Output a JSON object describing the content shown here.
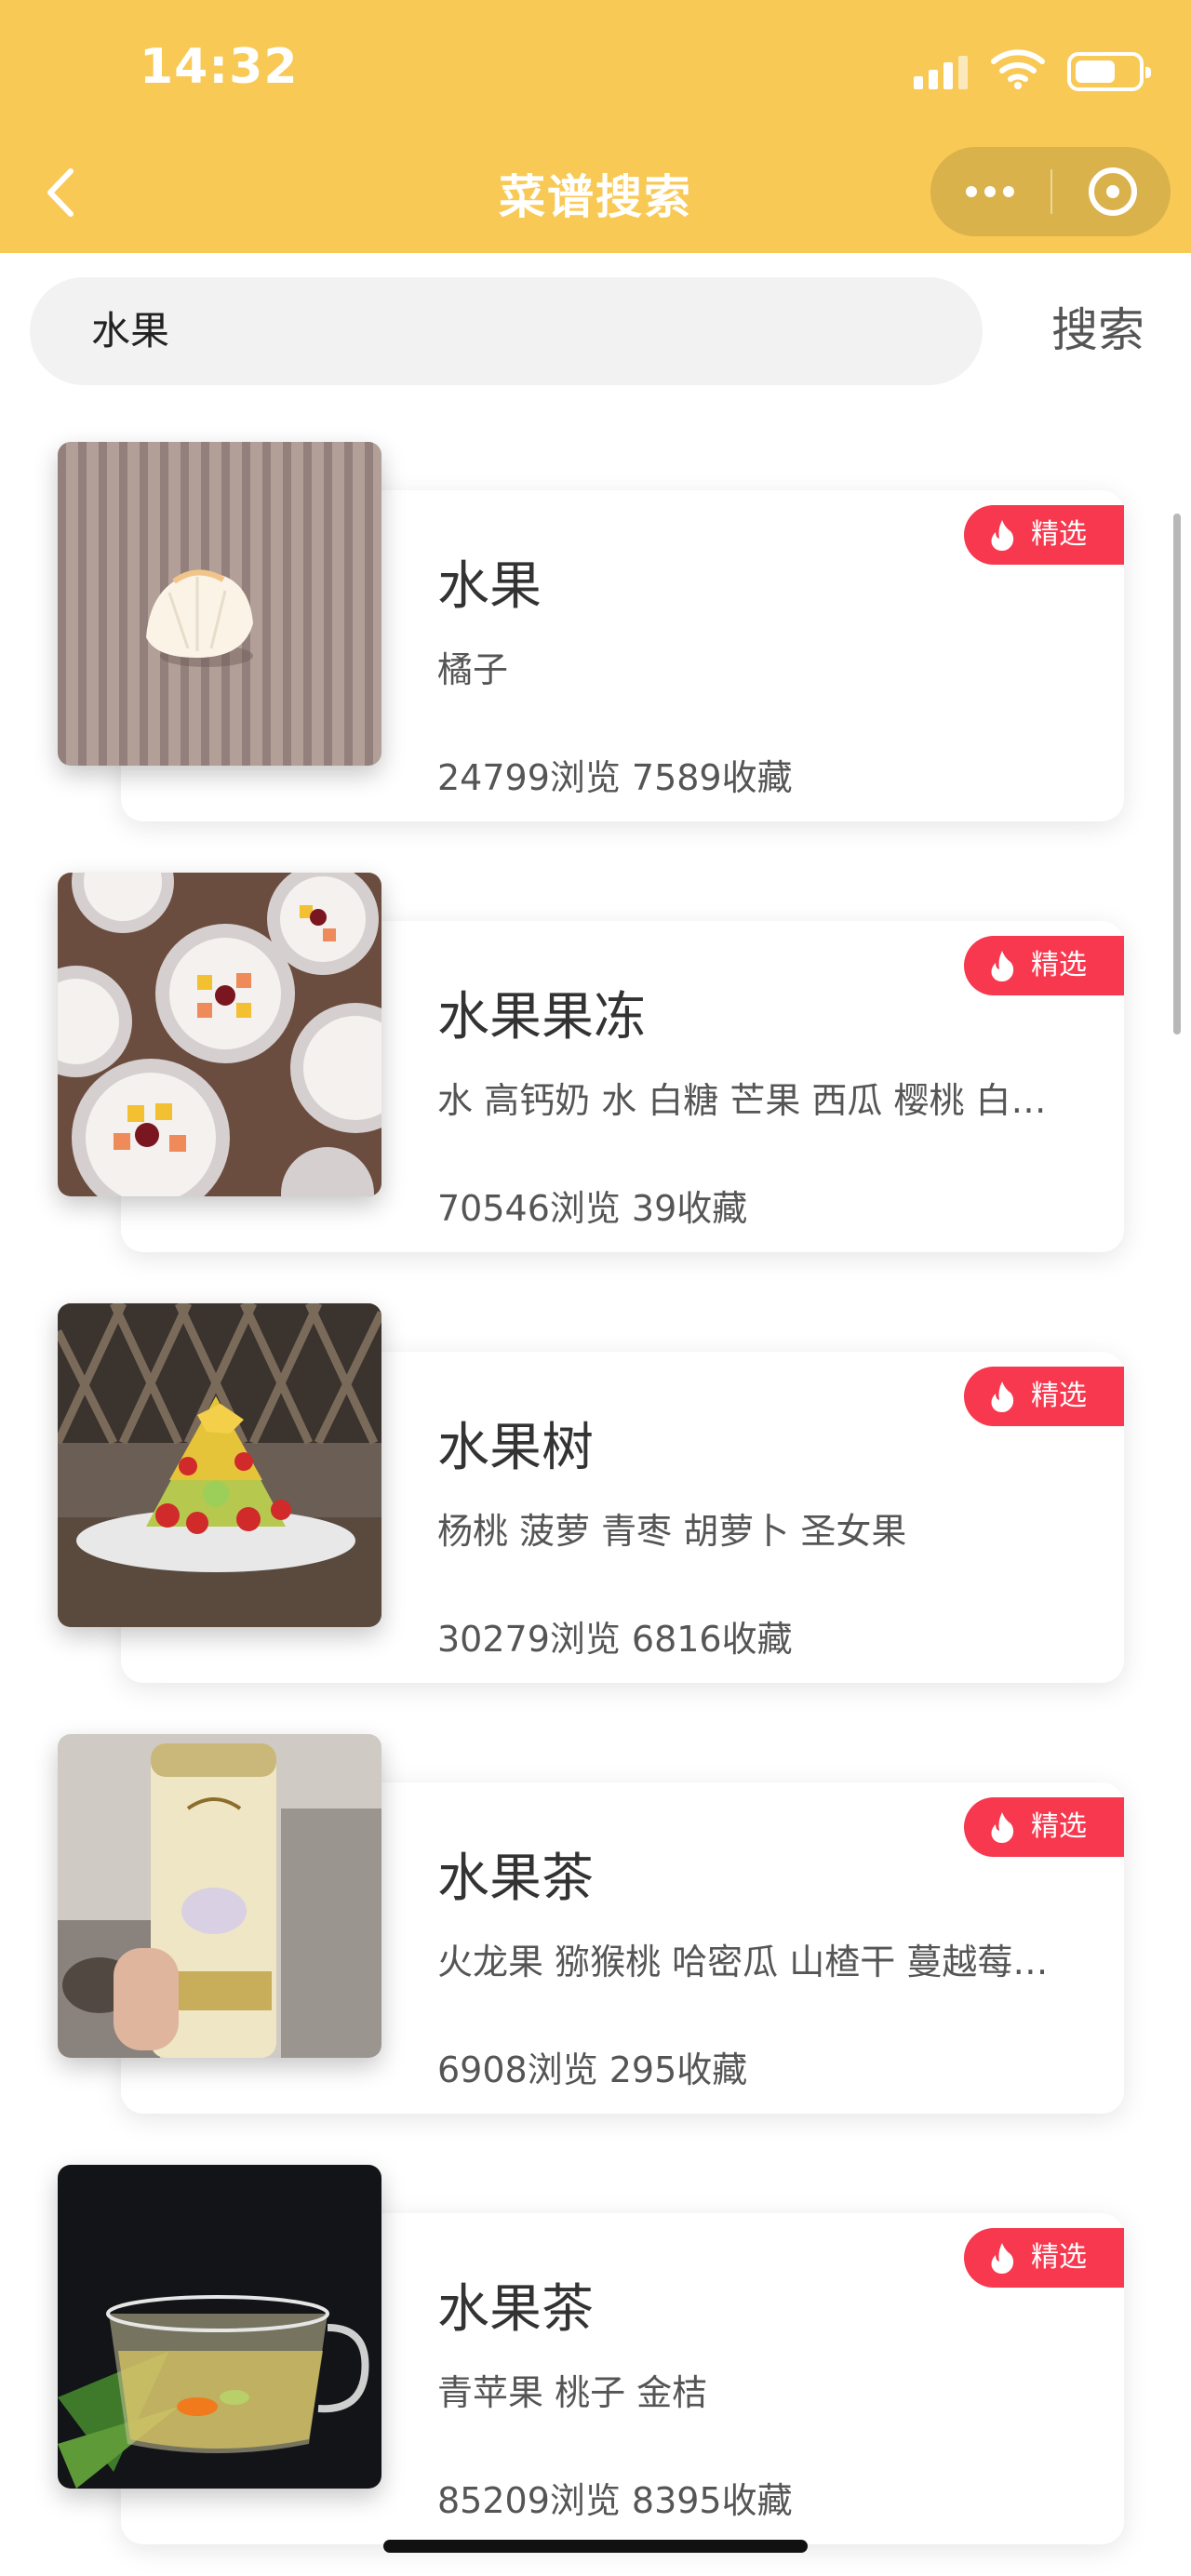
{
  "status_bar": {
    "time": "14:32"
  },
  "header": {
    "title": "菜谱搜索"
  },
  "search": {
    "value": "水果",
    "button_label": "搜索"
  },
  "colors": {
    "header_bg": "#f8c955",
    "badge_bg": "#f7384e"
  },
  "icons": [
    "chevron-left-icon",
    "more-dots-icon",
    "close-target-icon",
    "fire-icon",
    "signal-icon",
    "wifi-icon",
    "battery-icon"
  ],
  "recipes": [
    {
      "title": "水果",
      "ingredients": "橘子",
      "views": "24799浏览",
      "favorites": "7589收藏",
      "badge": "精选"
    },
    {
      "title": "水果果冻",
      "ingredients": "水 高钙奶 水 白糖 芒果 西瓜 樱桃 白…",
      "views": "70546浏览",
      "favorites": "39收藏",
      "badge": "精选"
    },
    {
      "title": "水果树",
      "ingredients": "杨桃 菠萝 青枣 胡萝卜 圣女果",
      "views": "30279浏览",
      "favorites": "6816收藏",
      "badge": "精选"
    },
    {
      "title": "水果茶",
      "ingredients": "火龙果 猕猴桃 哈密瓜 山楂干 蔓越莓…",
      "views": "6908浏览",
      "favorites": "295收藏",
      "badge": "精选"
    },
    {
      "title": "水果茶",
      "ingredients": "青苹果 桃子 金桔",
      "views": "85209浏览",
      "favorites": "8395收藏",
      "badge": "精选"
    }
  ]
}
